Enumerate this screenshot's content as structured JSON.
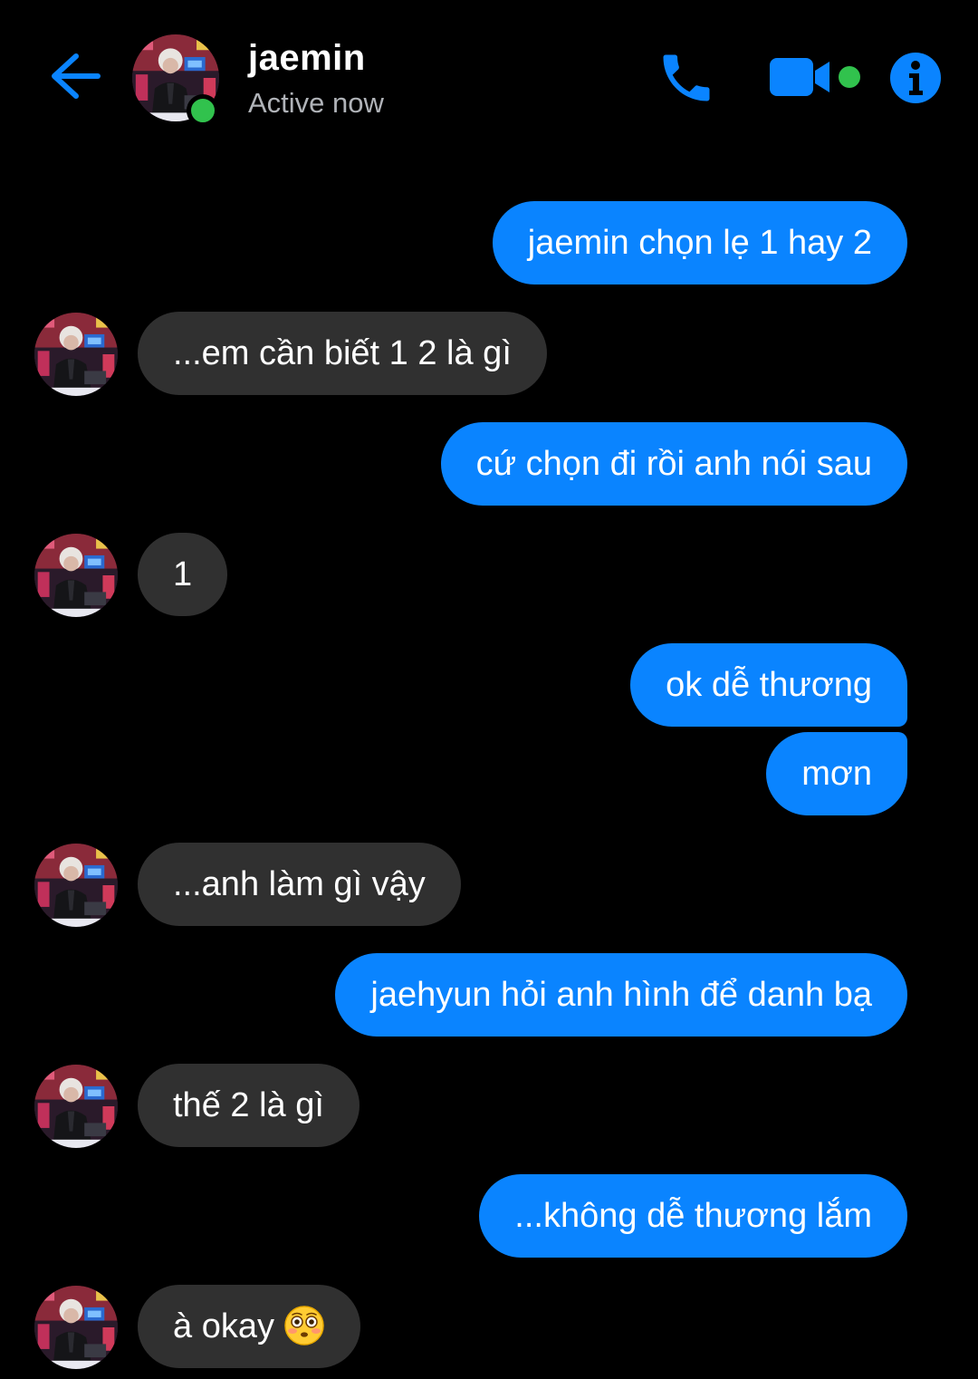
{
  "header": {
    "contact_name": "jaemin",
    "status": "Active now",
    "accent_color": "#0a84ff",
    "online_color": "#31c24d",
    "icons": [
      "back-arrow-icon",
      "phone-icon",
      "video-camera-icon",
      "info-icon"
    ]
  },
  "messages": [
    {
      "sender": "me",
      "text": "jaemin chọn lẹ 1 hay 2"
    },
    {
      "sender": "jaemin",
      "text": "...em cần biết 1 2 là gì"
    },
    {
      "sender": "me",
      "text": "cứ chọn đi rồi anh nói sau"
    },
    {
      "sender": "jaemin",
      "text": "1"
    },
    {
      "sender": "me",
      "text": "ok dễ thương"
    },
    {
      "sender": "me",
      "text": "mơn"
    },
    {
      "sender": "jaemin",
      "text": "...anh làm gì vậy"
    },
    {
      "sender": "me",
      "text": "jaehyun hỏi anh hình để danh bạ"
    },
    {
      "sender": "jaemin",
      "text": "thế 2 là gì"
    },
    {
      "sender": "me",
      "text": "...không dễ thương lắm"
    },
    {
      "sender": "jaemin",
      "text": "à okay",
      "emoji": "flushed-face-emoji"
    }
  ]
}
